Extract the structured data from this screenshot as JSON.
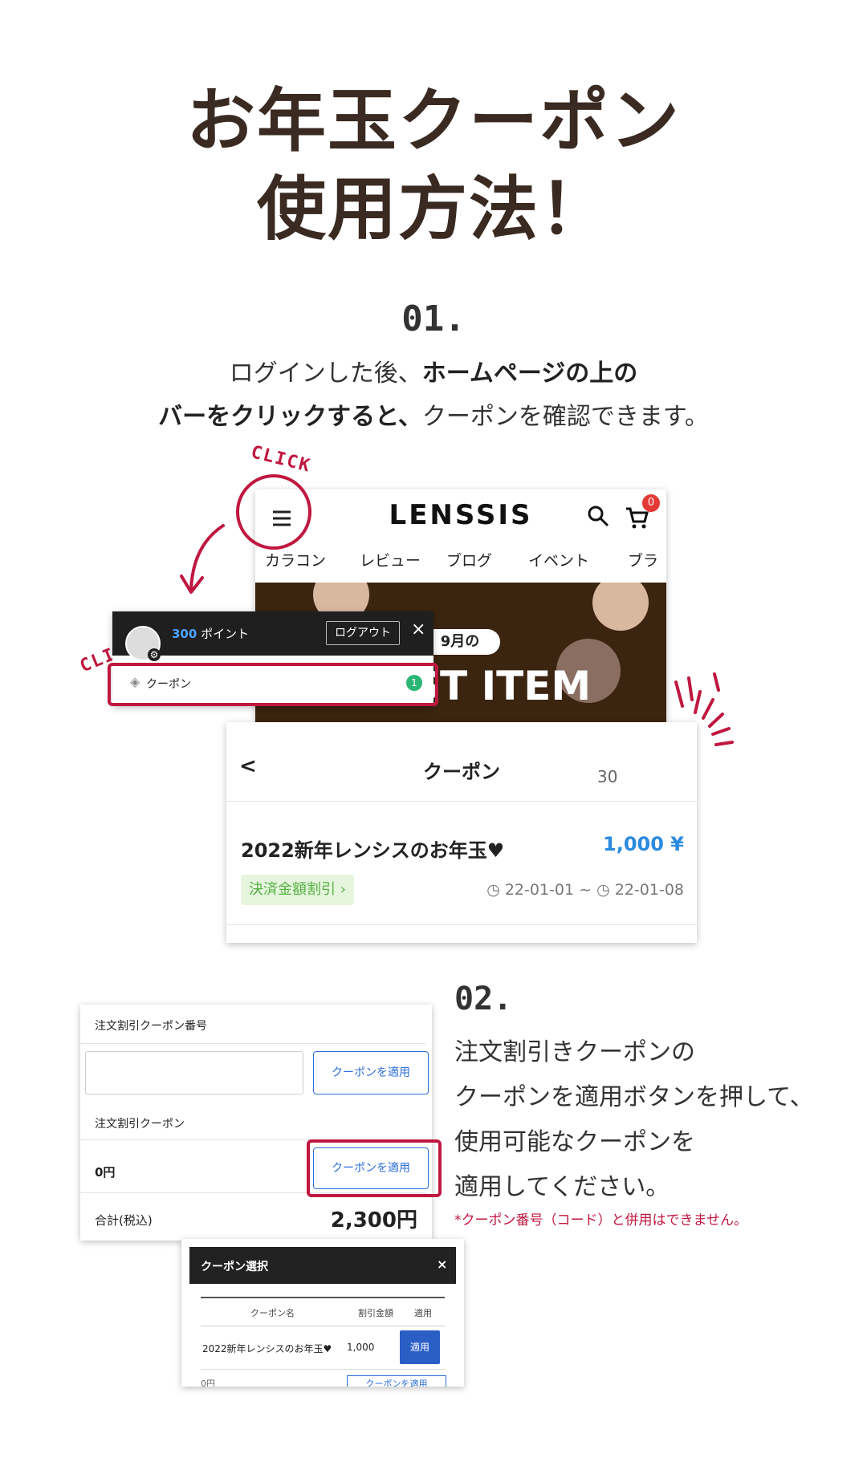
{
  "title": {
    "line1": "お年玉クーポン",
    "line2": "使用方法！"
  },
  "step1": {
    "number": "01.",
    "line1_a": "ログインした後、",
    "line1_b": "ホームページの上の",
    "line2_a": "バーをクリックすると、",
    "line2_b": "クーポンを確認できます。"
  },
  "click_label": "CLICK",
  "site": {
    "logo": "LENSSIS",
    "cart_count": "0",
    "nav": [
      "カラコン",
      "レビュー",
      "ブログ",
      "イベント",
      "ブラ"
    ],
    "banner_badge": "9月の",
    "banner_text": "BEST ITEM"
  },
  "drawer": {
    "points_value": "300",
    "points_label": "ポイント",
    "logout": "ログアウト",
    "close": "×",
    "coupon_label": "クーポン",
    "coupon_count": "1"
  },
  "coupon_page": {
    "back": "<",
    "title": "クーポン",
    "count": "30",
    "coupon_name": "2022新年レンシスのお年玉♥",
    "amount": "1,000 ¥",
    "tag": "決済金額割引 ›",
    "date_from": "22-01-01",
    "date_sep": "~",
    "date_to": "22-01-08"
  },
  "step2": {
    "number": "02.",
    "lines": [
      "注文割引きクーポンの",
      "クーポンを適用ボタンを押して、",
      "使用可能なクーポンを",
      "適用してください。"
    ],
    "note": "*クーポン番号（コード）と併用はできません。"
  },
  "order_form": {
    "code_label": "注文割引クーポン番号",
    "input_value": "",
    "apply_btn": "クーポンを適用",
    "coupon_label": "注文割引クーポン",
    "coupon_value": "0円",
    "total_label": "合計(税込)",
    "total_value": "2,300円"
  },
  "modal": {
    "title": "クーポン選択",
    "close": "×",
    "headers": [
      "クーポン名",
      "割引金額",
      "適用"
    ],
    "row": {
      "name": "2022新年レンシスのお年玉♥",
      "amount": "1,000",
      "apply": "適用"
    },
    "footer_left": "0円",
    "footer_btn": "クーポンを適用"
  },
  "colors": {
    "accent_red": "#c0173f",
    "brand_blue": "#2b6cdb",
    "title_brown": "#3a2a22",
    "banner_brown": "#3b2410"
  }
}
